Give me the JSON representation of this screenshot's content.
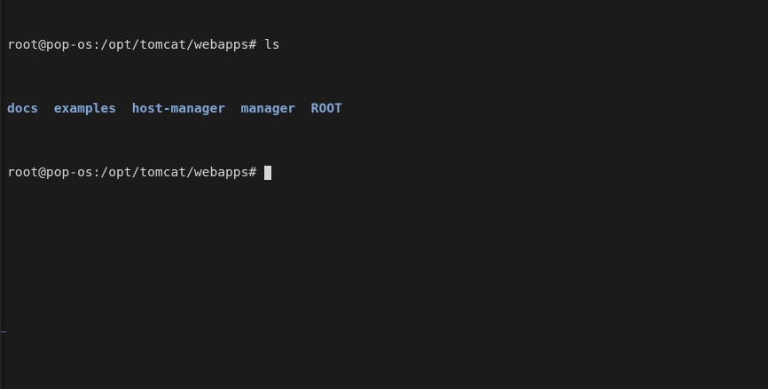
{
  "terminal": {
    "lines": [
      {
        "prompt": "root@pop-os:/opt/tomcat/webapps#",
        "command": "ls"
      }
    ],
    "ls_output": [
      "docs",
      "examples",
      "host-manager",
      "manager",
      "ROOT"
    ],
    "current_prompt": "root@pop-os:/opt/tomcat/webapps#"
  },
  "colors": {
    "background": "#1b1b1b",
    "text": "#d3d3d3",
    "directory": "#7fa6d6",
    "cursor": "#d6d6d6",
    "accent_mark": "#7a5cc7"
  }
}
